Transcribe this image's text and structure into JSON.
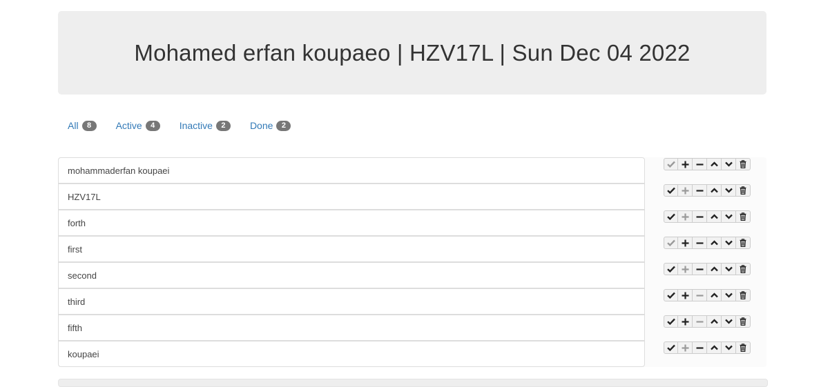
{
  "header": {
    "title": "Mohamed erfan koupaeo | HZV17L | Sun Dec 04 2022"
  },
  "filters": [
    {
      "label": "All",
      "count": "8"
    },
    {
      "label": "Active",
      "count": "4"
    },
    {
      "label": "Inactive",
      "count": "2"
    },
    {
      "label": "Done",
      "count": "2"
    }
  ],
  "items": [
    {
      "text": "mohammaderfan koupaei",
      "done_enabled": false,
      "plus_enabled": true,
      "minus_enabled": true
    },
    {
      "text": "HZV17L",
      "done_enabled": true,
      "plus_enabled": false,
      "minus_enabled": true
    },
    {
      "text": "forth",
      "done_enabled": true,
      "plus_enabled": false,
      "minus_enabled": true
    },
    {
      "text": "first",
      "done_enabled": false,
      "plus_enabled": true,
      "minus_enabled": true
    },
    {
      "text": "second",
      "done_enabled": true,
      "plus_enabled": false,
      "minus_enabled": true
    },
    {
      "text": "third",
      "done_enabled": true,
      "plus_enabled": true,
      "minus_enabled": false
    },
    {
      "text": "fifth",
      "done_enabled": true,
      "plus_enabled": true,
      "minus_enabled": false
    },
    {
      "text": "koupaei",
      "done_enabled": true,
      "plus_enabled": false,
      "minus_enabled": true
    }
  ],
  "icons": {
    "done": "checkmark-icon",
    "plus": "plus-icon",
    "minus": "minus-icon",
    "up": "chevron-up-icon",
    "down": "chevron-down-icon",
    "delete": "trash-icon"
  },
  "colors": {
    "link": "#337ab7",
    "badge": "#777777",
    "jumbotron": "#eeeeee",
    "disabled_icon": "#9a9a9a"
  }
}
